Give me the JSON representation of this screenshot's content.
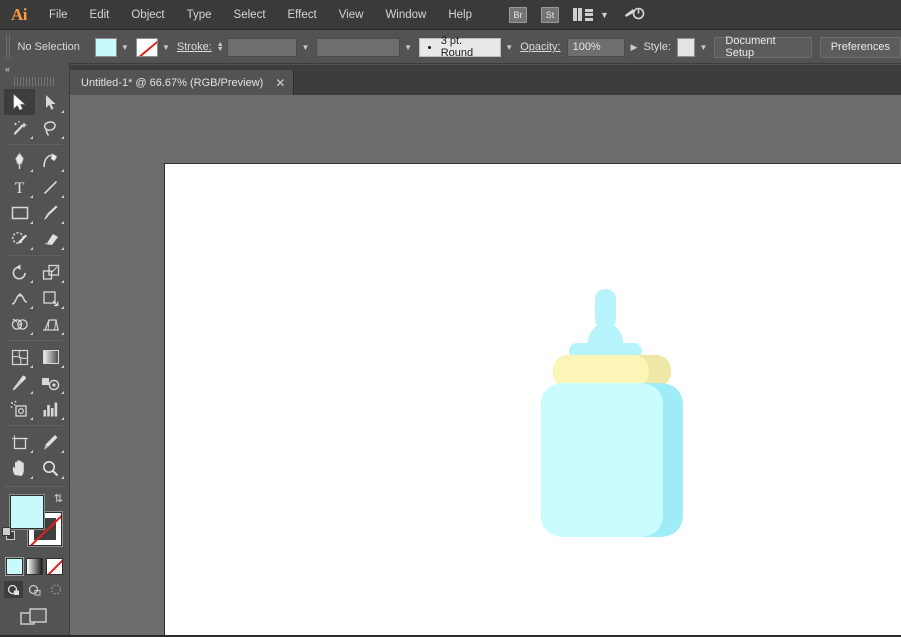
{
  "app": {
    "name": "Adobe Illustrator",
    "logo_text": "Ai"
  },
  "menubar": {
    "items": [
      {
        "label": "File"
      },
      {
        "label": "Edit"
      },
      {
        "label": "Object"
      },
      {
        "label": "Type"
      },
      {
        "label": "Select"
      },
      {
        "label": "Effect"
      },
      {
        "label": "View"
      },
      {
        "label": "Window"
      },
      {
        "label": "Help"
      }
    ],
    "bridge_label": "Br",
    "stock_label": "St",
    "arrange_icon": "arrange-documents-icon",
    "chevron_icon": "chevron-down-icon",
    "workspace_icon": "workspace-switcher-icon"
  },
  "controlbar": {
    "selection_status": "No Selection",
    "fill_swatch_color": "#c8fafc",
    "stroke_swatch_value": "None",
    "stroke_label": "Stroke:",
    "stroke_weight_value": "",
    "stroke_profile_value": "",
    "brush_value": "3 pt. Round",
    "opacity_label": "Opacity:",
    "opacity_value": "100%",
    "style_label": "Style:",
    "style_swatch_color": "#e4e4e4",
    "document_setup_label": "Document Setup",
    "preferences_label": "Preferences"
  },
  "tabbar": {
    "tabs": [
      {
        "title": "Untitled-1* @ 66.67% (RGB/Preview)",
        "close_icon": "close-icon",
        "active": true
      }
    ]
  },
  "toolpanel": {
    "collapse_icon": "double-chevron-left-icon",
    "tools": [
      {
        "name": "selection-tool",
        "active": true
      },
      {
        "name": "direct-selection-tool",
        "active": false
      },
      {
        "name": "magic-wand-tool",
        "active": false
      },
      {
        "name": "lasso-tool",
        "active": false
      },
      {
        "name": "pen-tool",
        "active": false
      },
      {
        "name": "curvature-tool",
        "active": false
      },
      {
        "name": "type-tool",
        "active": false
      },
      {
        "name": "line-segment-tool",
        "active": false
      },
      {
        "name": "rectangle-tool",
        "active": false
      },
      {
        "name": "paintbrush-tool",
        "active": false
      },
      {
        "name": "shaper-pencil-tool",
        "active": false
      },
      {
        "name": "eraser-tool",
        "active": false
      },
      {
        "name": "rotate-tool",
        "active": false
      },
      {
        "name": "scale-tool",
        "active": false
      },
      {
        "name": "width-warp-tool",
        "active": false
      },
      {
        "name": "free-transform-tool",
        "active": false
      },
      {
        "name": "shape-builder-tool",
        "active": false
      },
      {
        "name": "perspective-grid-tool",
        "active": false
      },
      {
        "name": "mesh-tool",
        "active": false
      },
      {
        "name": "gradient-tool",
        "active": false
      },
      {
        "name": "eyedropper-tool",
        "active": false
      },
      {
        "name": "blend-tool",
        "active": false
      },
      {
        "name": "symbol-sprayer-tool",
        "active": false
      },
      {
        "name": "column-graph-tool",
        "active": false
      },
      {
        "name": "artboard-tool",
        "active": false
      },
      {
        "name": "slice-tool",
        "active": false
      },
      {
        "name": "hand-tool",
        "active": false
      },
      {
        "name": "zoom-tool",
        "active": false
      }
    ],
    "fill_color": "#c8fafc",
    "stroke_color": "None",
    "swap_icon": "swap-fill-stroke-icon",
    "default_icon": "default-fill-stroke-icon",
    "color_modes": [
      {
        "name": "color-mode",
        "selected": true
      },
      {
        "name": "gradient-mode",
        "selected": false
      },
      {
        "name": "none-mode",
        "selected": false
      }
    ],
    "draw_modes": [
      {
        "name": "draw-normal-mode",
        "selected": true
      },
      {
        "name": "draw-behind-mode",
        "selected": false
      },
      {
        "name": "draw-inside-mode",
        "selected": false
      }
    ],
    "screen_mode_icon": "change-screen-mode-icon"
  },
  "canvas": {
    "backdrop_color": "#6d6d6d",
    "artboard_color": "#ffffff",
    "zoom_level": "66.67%"
  },
  "artwork": {
    "name": "baby-bottle-illustration",
    "colors": {
      "body_light": "#c9fbff",
      "body_shade": "#9fecf7",
      "nipple": "#b6f3fb",
      "collar_light": "#fbf5b8",
      "collar_shade": "#efe7a6"
    }
  }
}
